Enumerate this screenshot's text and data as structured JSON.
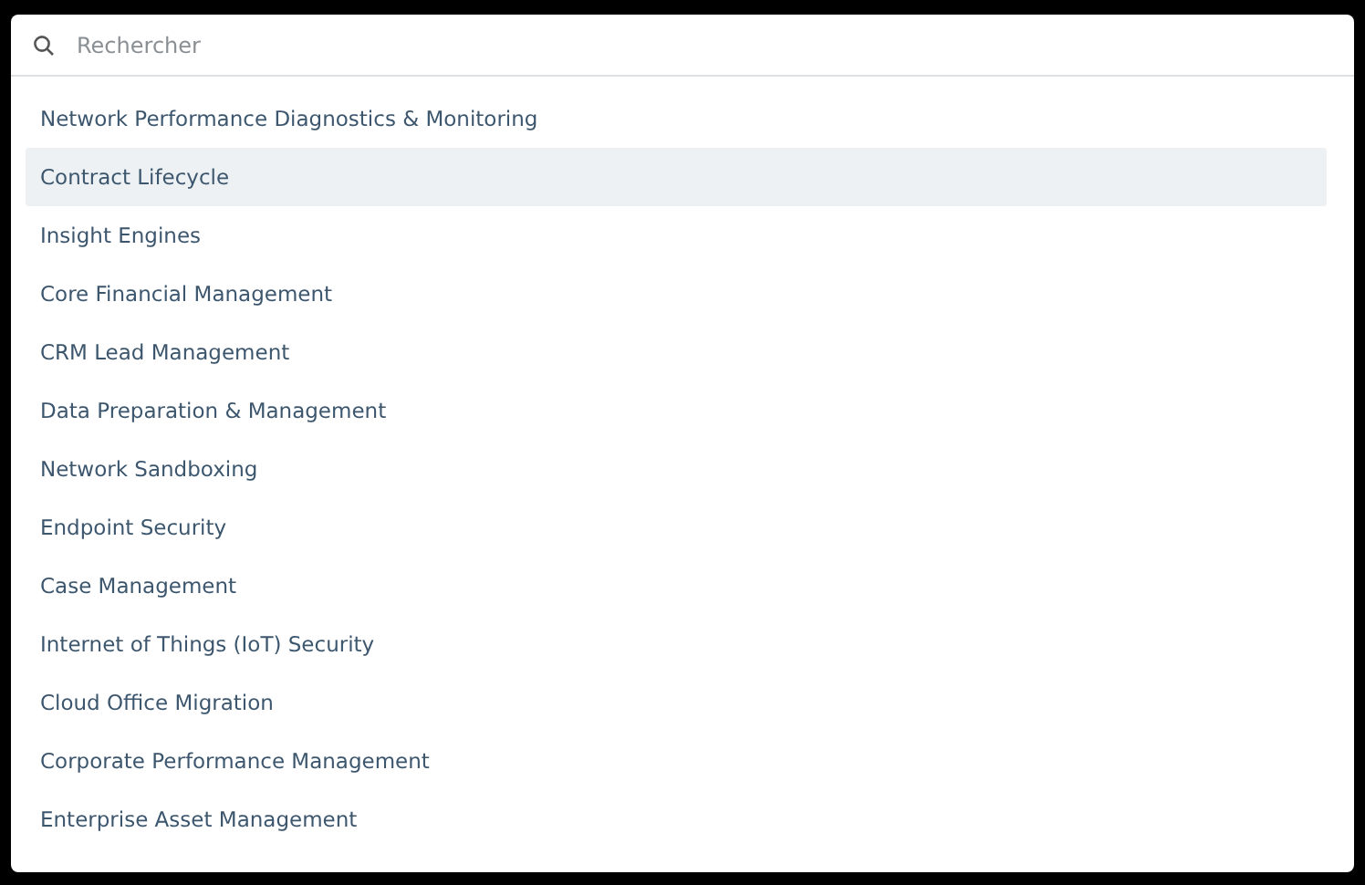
{
  "search": {
    "placeholder": "Rechercher"
  },
  "items": [
    {
      "label": "Network Performance Diagnostics & Monitoring",
      "selected": false
    },
    {
      "label": "Contract Lifecycle",
      "selected": true
    },
    {
      "label": "Insight Engines",
      "selected": false
    },
    {
      "label": "Core Financial Management",
      "selected": false
    },
    {
      "label": "CRM Lead Management",
      "selected": false
    },
    {
      "label": "Data Preparation & Management",
      "selected": false
    },
    {
      "label": "Network Sandboxing",
      "selected": false
    },
    {
      "label": "Endpoint Security",
      "selected": false
    },
    {
      "label": "Case Management",
      "selected": false
    },
    {
      "label": "Internet of Things (IoT) Security",
      "selected": false
    },
    {
      "label": "Cloud Office Migration",
      "selected": false
    },
    {
      "label": "Corporate Performance Management",
      "selected": false
    },
    {
      "label": "Enterprise Asset Management",
      "selected": false
    }
  ]
}
